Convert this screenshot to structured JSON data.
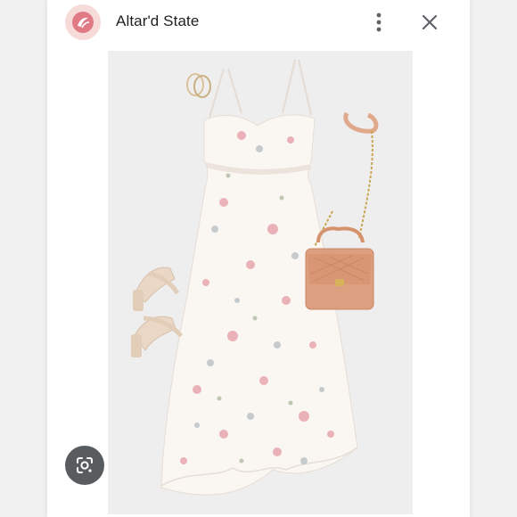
{
  "header": {
    "source_name": "Altar'd State",
    "avatar_icon": "altard-state-logo-icon",
    "menu_icon": "more-vert-icon",
    "close_icon": "close-icon"
  },
  "image": {
    "lens_icon": "google-lens-icon"
  },
  "colors": {
    "avatar_bg": "#f6dbd9",
    "brand_accent": "#e07b86",
    "title_text": "#202124",
    "icon_gray": "#5f6368"
  }
}
